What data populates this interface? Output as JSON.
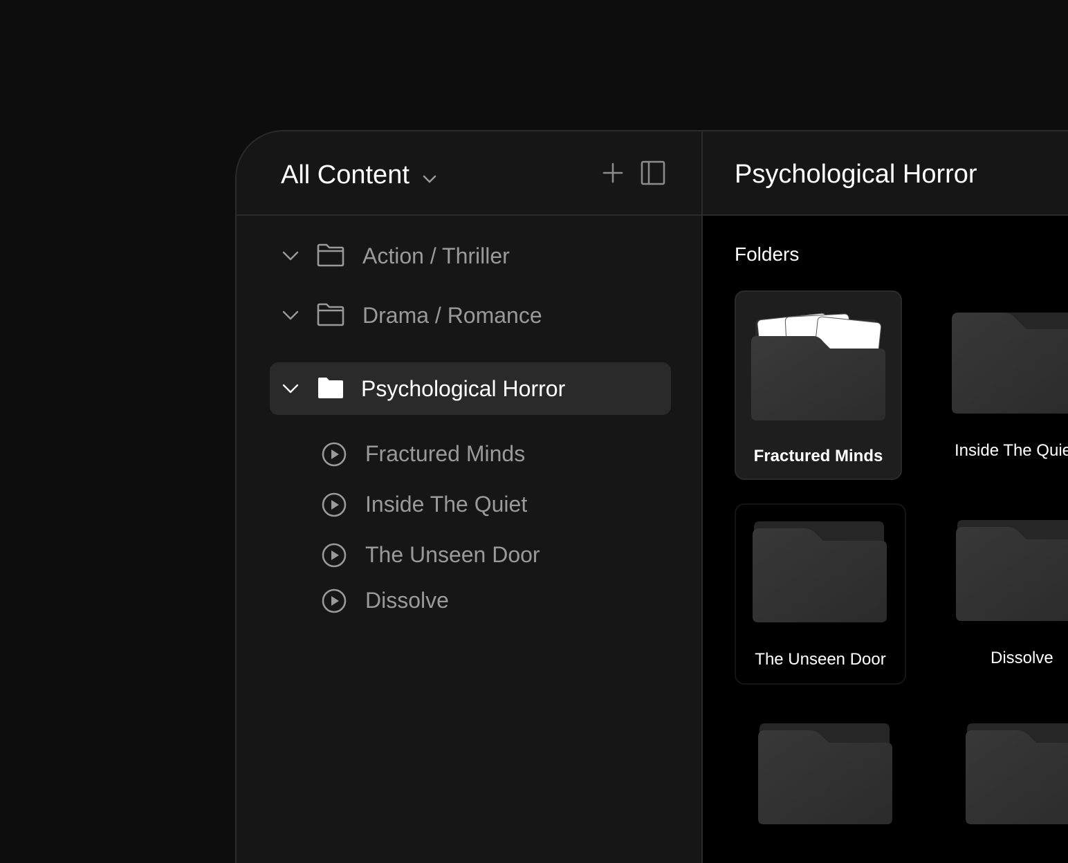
{
  "sidebar": {
    "title": "All Content",
    "icons": {
      "title_chevron": "chevron-down-icon",
      "add": "plus-icon",
      "toggle_panel": "sidebar-panel-icon"
    },
    "folders": [
      {
        "label": "Action / Thriller",
        "expanded": false,
        "active": false
      },
      {
        "label": "Drama / Romance",
        "expanded": false,
        "active": false
      },
      {
        "label": "Psychological Horror",
        "expanded": true,
        "active": true
      }
    ],
    "children": [
      {
        "label": "Fractured Minds",
        "icon": "play-circle-icon"
      },
      {
        "label": "Inside The Quiet",
        "icon": "play-circle-icon"
      },
      {
        "label": "The Unseen Door",
        "icon": "play-circle-icon"
      },
      {
        "label": "Dissolve",
        "icon": "play-circle-icon"
      }
    ]
  },
  "main": {
    "title": "Psychological Horror",
    "section_label": "Folders",
    "folders": [
      {
        "name": "Fractured Minds",
        "selected": true
      },
      {
        "name": "Inside The Quiet",
        "selected": false
      },
      {
        "name": "The Unseen Door",
        "selected": false
      },
      {
        "name": "Dissolve",
        "selected": false
      },
      {
        "name": "",
        "selected": false
      },
      {
        "name": "",
        "selected": false
      }
    ]
  },
  "colors": {
    "background": "#0d0d0d",
    "sidebar": "#161616",
    "main": "#000000",
    "active_row": "#2a2a2a",
    "text_primary": "#ffffff",
    "text_muted": "#9a9a9a"
  }
}
